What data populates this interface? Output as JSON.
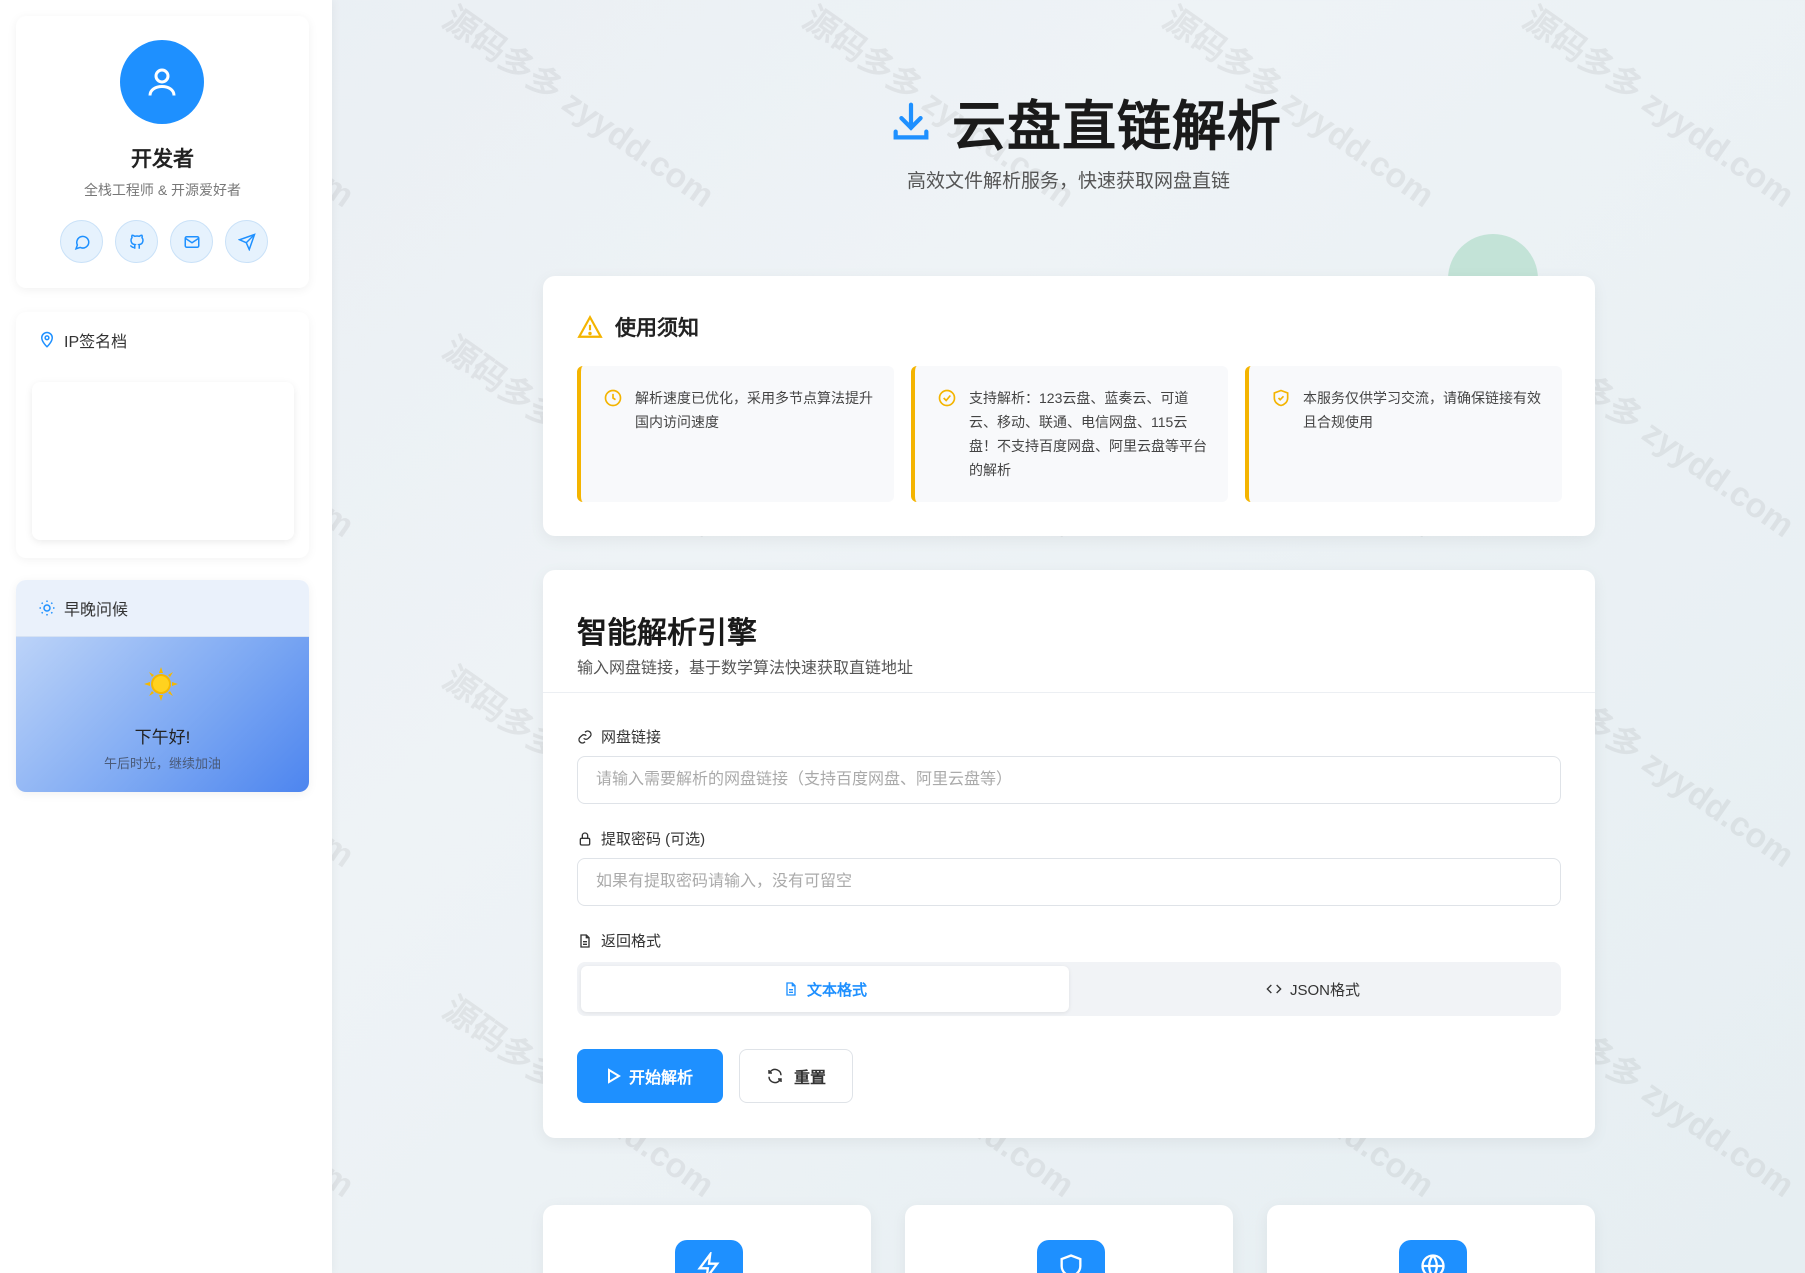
{
  "profile": {
    "name": "开发者",
    "role": "全栈工程师 & 开源爱好者"
  },
  "ip_card": {
    "title": "IP签名档"
  },
  "greeting": {
    "title": "早晚问候",
    "text": "下午好!",
    "sub": "午后时光，继续加油"
  },
  "header": {
    "title": "云盘直链解析",
    "subtitle": "高效文件解析服务，快速获取网盘直链"
  },
  "notice": {
    "title": "使用须知",
    "items": [
      {
        "text": "解析速度已优化，采用多节点算法提升国内访问速度",
        "icon": "clock-icon"
      },
      {
        "text": "支持解析：123云盘、蓝奏云、可道云、移动、联通、电信网盘、115云盘！不支持百度网盘、阿里云盘等平台的解析",
        "icon": "check-circle-icon"
      },
      {
        "text": "本服务仅供学习交流，请确保链接有效且合规使用",
        "icon": "shield-check-icon"
      }
    ]
  },
  "engine": {
    "title": "智能解析引擎",
    "subtitle": "输入网盘链接，基于数学算法快速获取直链地址",
    "link_label": "网盘链接",
    "link_placeholder": "请输入需要解析的网盘链接（支持百度网盘、阿里云盘等）",
    "pwd_label": "提取密码 (可选)",
    "pwd_placeholder": "如果有提取密码请输入，没有可留空",
    "format_label": "返回格式",
    "format_text": "文本格式",
    "format_json": "JSON格式",
    "selected_format": "文本格式",
    "start_button": "开始解析",
    "reset_button": "重置"
  },
  "watermark": "源码多多 zyydd.com",
  "colors": {
    "accent": "#1e90ff",
    "warning": "#f4b400"
  }
}
